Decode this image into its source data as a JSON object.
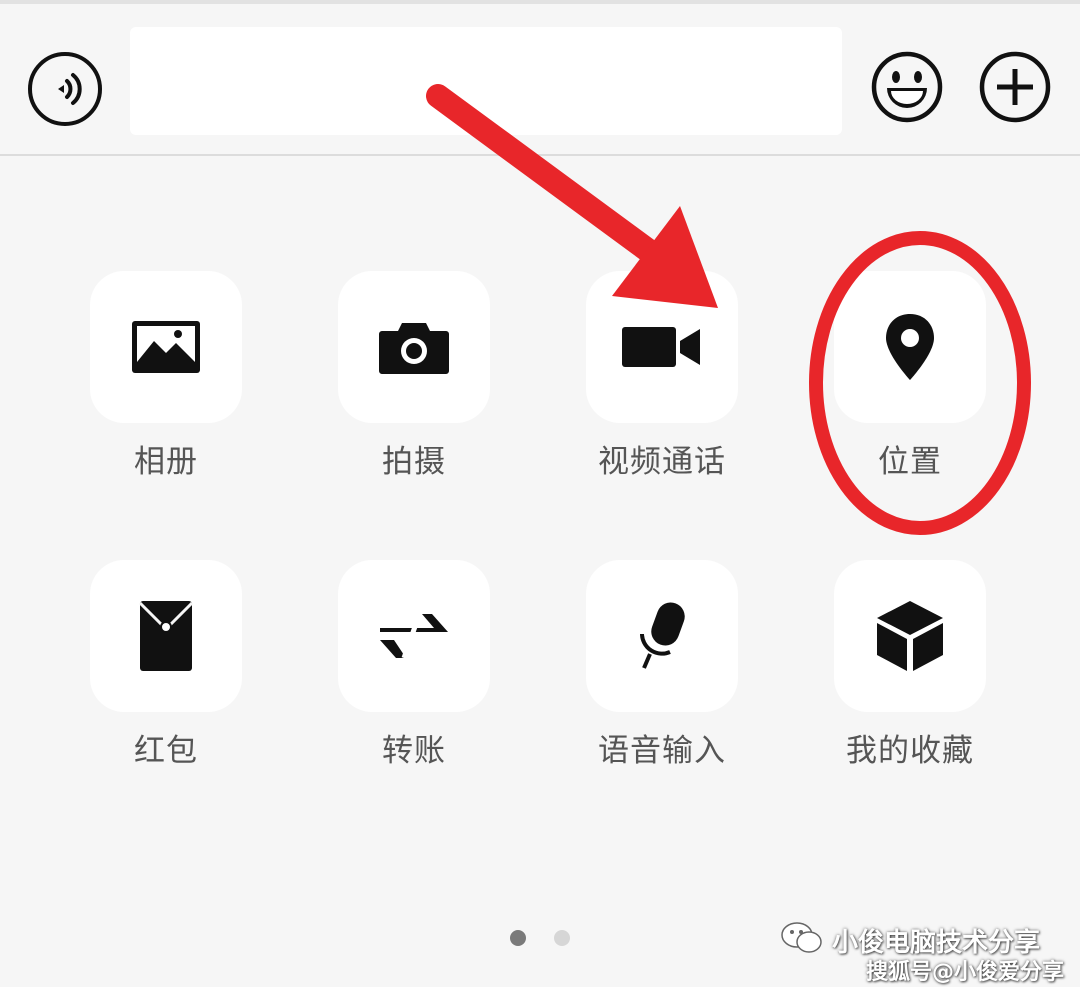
{
  "input_bar": {
    "voice_icon": "voice-icon",
    "input_value": "",
    "input_placeholder": "",
    "emoji_icon": "emoji-icon",
    "plus_icon": "plus-icon"
  },
  "panel": {
    "items": [
      {
        "label": "相册",
        "icon": "photo-album-icon"
      },
      {
        "label": "拍摄",
        "icon": "camera-icon"
      },
      {
        "label": "视频通话",
        "icon": "video-call-icon"
      },
      {
        "label": "位置",
        "icon": "location-pin-icon"
      },
      {
        "label": "红包",
        "icon": "red-envelope-icon"
      },
      {
        "label": "转账",
        "icon": "transfer-icon"
      },
      {
        "label": "语音输入",
        "icon": "microphone-icon"
      },
      {
        "label": "我的收藏",
        "icon": "favorites-cube-icon"
      }
    ],
    "page_indicator": {
      "pages": 2,
      "current": 1
    }
  },
  "watermark": {
    "line1": "小俊电脑技术分享",
    "line2": "搜狐号@小俊爱分享"
  },
  "annotations": {
    "color": "#e8262a",
    "arrow": "arrow pointing to 视频通话",
    "circle": "circle around 位置"
  },
  "colors": {
    "background": "#f6f6f6",
    "tile": "#ffffff",
    "icon": "#111111",
    "label": "#555555",
    "dot_active": "#7a7a7a",
    "dot_inactive": "#d6d6d6"
  }
}
